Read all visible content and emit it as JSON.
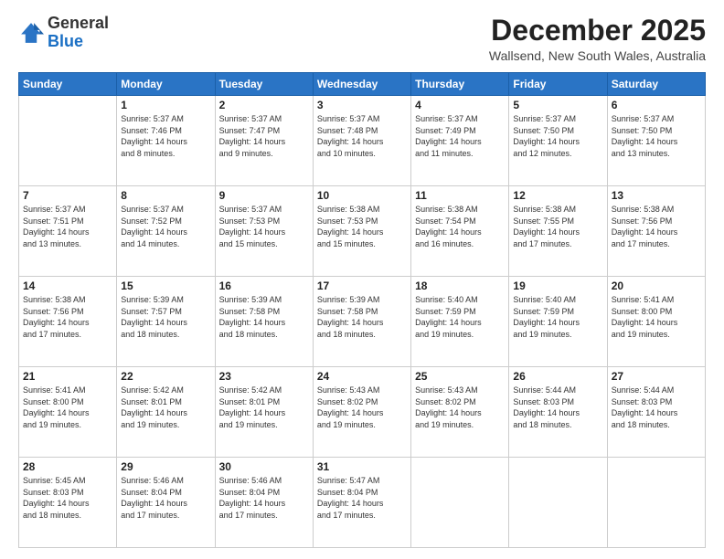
{
  "logo": {
    "general": "General",
    "blue": "Blue"
  },
  "header": {
    "month_title": "December 2025",
    "location": "Wallsend, New South Wales, Australia"
  },
  "weekdays": [
    "Sunday",
    "Monday",
    "Tuesday",
    "Wednesday",
    "Thursday",
    "Friday",
    "Saturday"
  ],
  "weeks": [
    [
      {
        "day": "",
        "info": ""
      },
      {
        "day": "1",
        "info": "Sunrise: 5:37 AM\nSunset: 7:46 PM\nDaylight: 14 hours\nand 8 minutes."
      },
      {
        "day": "2",
        "info": "Sunrise: 5:37 AM\nSunset: 7:47 PM\nDaylight: 14 hours\nand 9 minutes."
      },
      {
        "day": "3",
        "info": "Sunrise: 5:37 AM\nSunset: 7:48 PM\nDaylight: 14 hours\nand 10 minutes."
      },
      {
        "day": "4",
        "info": "Sunrise: 5:37 AM\nSunset: 7:49 PM\nDaylight: 14 hours\nand 11 minutes."
      },
      {
        "day": "5",
        "info": "Sunrise: 5:37 AM\nSunset: 7:50 PM\nDaylight: 14 hours\nand 12 minutes."
      },
      {
        "day": "6",
        "info": "Sunrise: 5:37 AM\nSunset: 7:50 PM\nDaylight: 14 hours\nand 13 minutes."
      }
    ],
    [
      {
        "day": "7",
        "info": "Sunrise: 5:37 AM\nSunset: 7:51 PM\nDaylight: 14 hours\nand 13 minutes."
      },
      {
        "day": "8",
        "info": "Sunrise: 5:37 AM\nSunset: 7:52 PM\nDaylight: 14 hours\nand 14 minutes."
      },
      {
        "day": "9",
        "info": "Sunrise: 5:37 AM\nSunset: 7:53 PM\nDaylight: 14 hours\nand 15 minutes."
      },
      {
        "day": "10",
        "info": "Sunrise: 5:38 AM\nSunset: 7:53 PM\nDaylight: 14 hours\nand 15 minutes."
      },
      {
        "day": "11",
        "info": "Sunrise: 5:38 AM\nSunset: 7:54 PM\nDaylight: 14 hours\nand 16 minutes."
      },
      {
        "day": "12",
        "info": "Sunrise: 5:38 AM\nSunset: 7:55 PM\nDaylight: 14 hours\nand 17 minutes."
      },
      {
        "day": "13",
        "info": "Sunrise: 5:38 AM\nSunset: 7:56 PM\nDaylight: 14 hours\nand 17 minutes."
      }
    ],
    [
      {
        "day": "14",
        "info": "Sunrise: 5:38 AM\nSunset: 7:56 PM\nDaylight: 14 hours\nand 17 minutes."
      },
      {
        "day": "15",
        "info": "Sunrise: 5:39 AM\nSunset: 7:57 PM\nDaylight: 14 hours\nand 18 minutes."
      },
      {
        "day": "16",
        "info": "Sunrise: 5:39 AM\nSunset: 7:58 PM\nDaylight: 14 hours\nand 18 minutes."
      },
      {
        "day": "17",
        "info": "Sunrise: 5:39 AM\nSunset: 7:58 PM\nDaylight: 14 hours\nand 18 minutes."
      },
      {
        "day": "18",
        "info": "Sunrise: 5:40 AM\nSunset: 7:59 PM\nDaylight: 14 hours\nand 19 minutes."
      },
      {
        "day": "19",
        "info": "Sunrise: 5:40 AM\nSunset: 7:59 PM\nDaylight: 14 hours\nand 19 minutes."
      },
      {
        "day": "20",
        "info": "Sunrise: 5:41 AM\nSunset: 8:00 PM\nDaylight: 14 hours\nand 19 minutes."
      }
    ],
    [
      {
        "day": "21",
        "info": "Sunrise: 5:41 AM\nSunset: 8:00 PM\nDaylight: 14 hours\nand 19 minutes."
      },
      {
        "day": "22",
        "info": "Sunrise: 5:42 AM\nSunset: 8:01 PM\nDaylight: 14 hours\nand 19 minutes."
      },
      {
        "day": "23",
        "info": "Sunrise: 5:42 AM\nSunset: 8:01 PM\nDaylight: 14 hours\nand 19 minutes."
      },
      {
        "day": "24",
        "info": "Sunrise: 5:43 AM\nSunset: 8:02 PM\nDaylight: 14 hours\nand 19 minutes."
      },
      {
        "day": "25",
        "info": "Sunrise: 5:43 AM\nSunset: 8:02 PM\nDaylight: 14 hours\nand 19 minutes."
      },
      {
        "day": "26",
        "info": "Sunrise: 5:44 AM\nSunset: 8:03 PM\nDaylight: 14 hours\nand 18 minutes."
      },
      {
        "day": "27",
        "info": "Sunrise: 5:44 AM\nSunset: 8:03 PM\nDaylight: 14 hours\nand 18 minutes."
      }
    ],
    [
      {
        "day": "28",
        "info": "Sunrise: 5:45 AM\nSunset: 8:03 PM\nDaylight: 14 hours\nand 18 minutes."
      },
      {
        "day": "29",
        "info": "Sunrise: 5:46 AM\nSunset: 8:04 PM\nDaylight: 14 hours\nand 17 minutes."
      },
      {
        "day": "30",
        "info": "Sunrise: 5:46 AM\nSunset: 8:04 PM\nDaylight: 14 hours\nand 17 minutes."
      },
      {
        "day": "31",
        "info": "Sunrise: 5:47 AM\nSunset: 8:04 PM\nDaylight: 14 hours\nand 17 minutes."
      },
      {
        "day": "",
        "info": ""
      },
      {
        "day": "",
        "info": ""
      },
      {
        "day": "",
        "info": ""
      }
    ]
  ]
}
